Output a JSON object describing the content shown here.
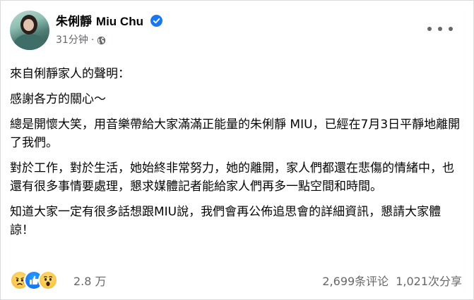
{
  "author": {
    "name_cn": "朱俐靜",
    "name_en": "Miu Chu",
    "verified": true
  },
  "post": {
    "time": "31分钟",
    "dot": "·",
    "audience_icon": "globe-icon",
    "paragraphs": [
      "來自俐靜家人的聲明：",
      "感謝各方的關心～",
      "總是開懷大笑，用音樂帶給大家滿滿正能量的朱俐靜 MIU，已經在7月3日平靜地離開了我們。",
      "對於工作，對於生活，她始終非常努力，她的離開，家人們都還在悲傷的情緒中，也還有很多事情要處理，懇求媒體記者能給家人們再多一點空間和時間。",
      "知道大家一定有很多話想跟MIU說，我們會再公佈追思會的詳細資訊，懇請大家體諒！"
    ]
  },
  "engagement": {
    "reactions": [
      "sad-reaction-icon",
      "like-reaction-icon",
      "wow-reaction-icon"
    ],
    "reaction_count": "2.8 万",
    "comments": "2,699条评论",
    "shares": "1,021次分享"
  },
  "colors": {
    "text": "#050505",
    "secondary": "#65676b",
    "verified": "#1877f2",
    "like": "#1877f2",
    "border": "#d8dadf"
  }
}
